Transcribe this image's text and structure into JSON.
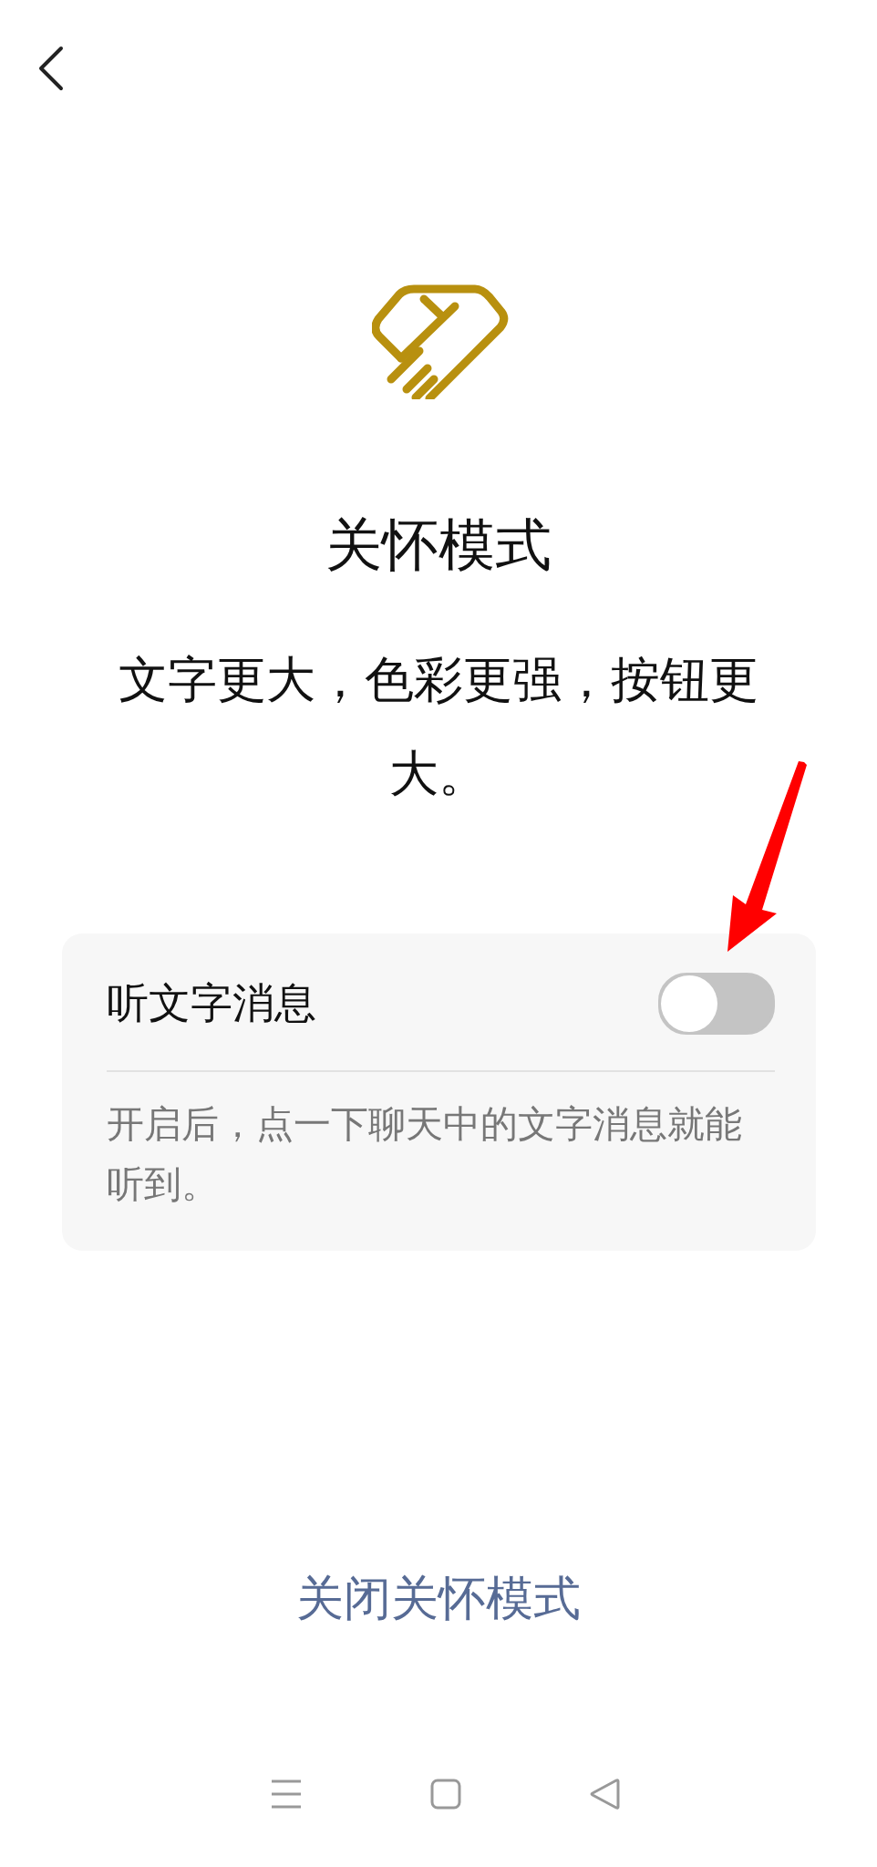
{
  "title": "关怀模式",
  "subtitle": "文字更大，色彩更强，按钮更大。",
  "setting": {
    "label": "听文字消息",
    "on": false,
    "description": "开启后，点一下聊天中的文字消息就能听到。"
  },
  "close_link": "关闭关怀模式"
}
